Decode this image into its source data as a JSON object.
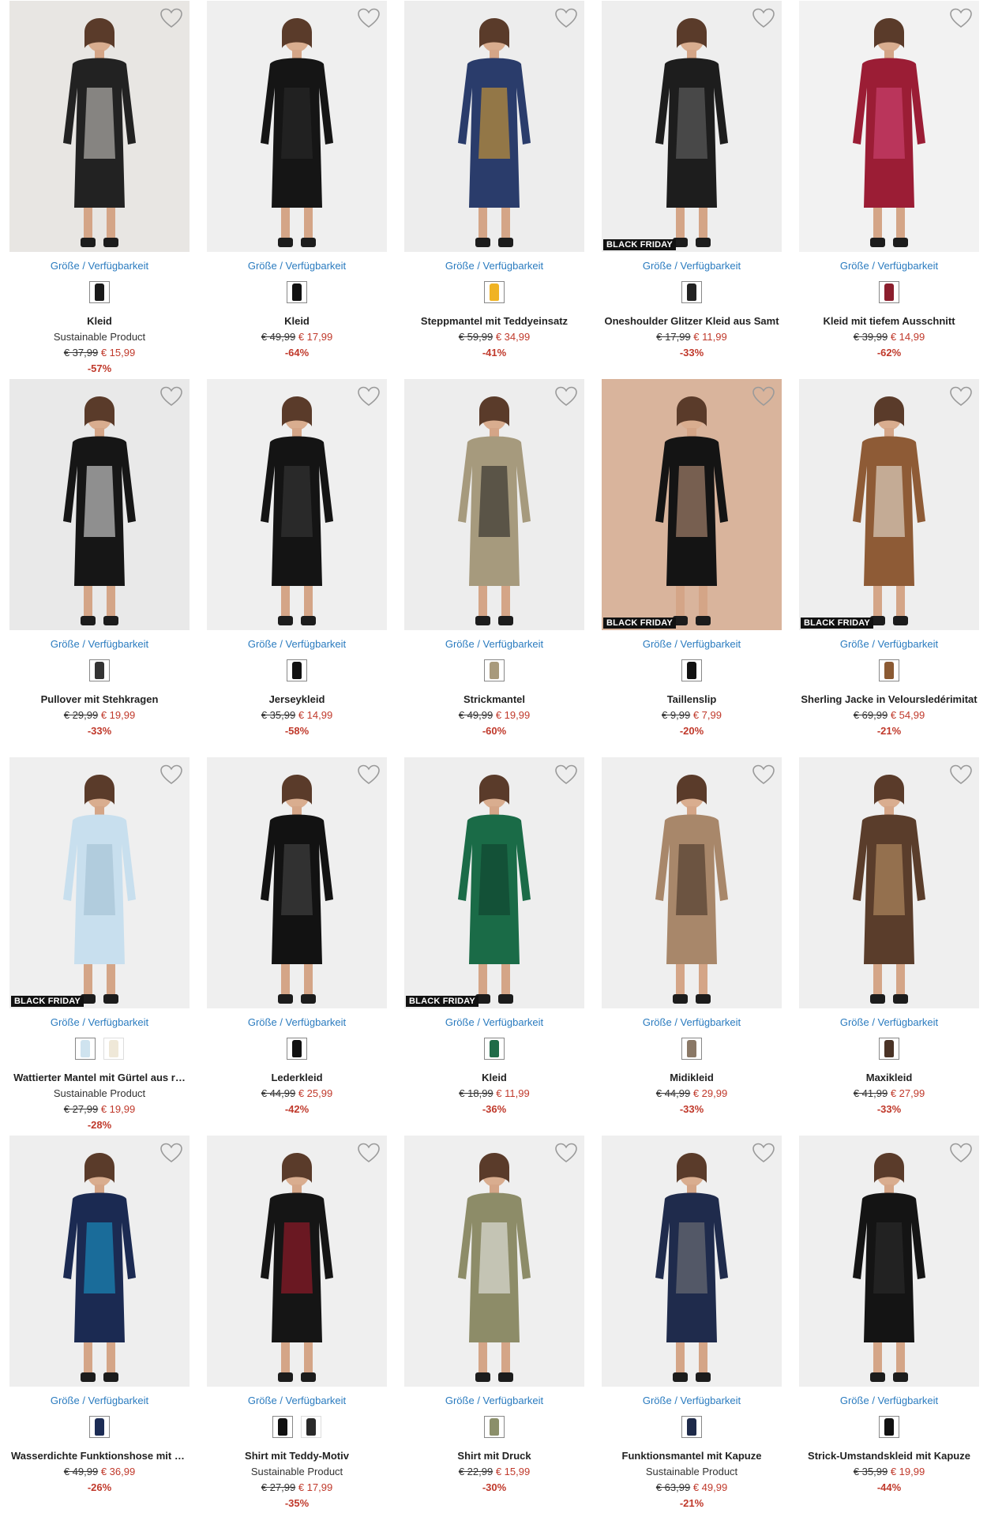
{
  "common": {
    "size_link": "Größe / Verfügbarkeit",
    "badge_black_friday": "BLACK FRIDAY",
    "heart_icon": "heart-outline-icon"
  },
  "products": [
    {
      "title": "Kleid",
      "sustainable": "Sustainable Product",
      "old_price": "€ 37,99",
      "new_price": "€ 15,99",
      "discount": "-57%",
      "black_friday": false,
      "swatches": [
        "#1a1a1a"
      ],
      "image_color": "#e8e6e3",
      "garment": "#222222",
      "accent": "#d9d6cf"
    },
    {
      "title": "Kleid",
      "sustainable": "",
      "old_price": "€ 49,99",
      "new_price": "€ 17,99",
      "discount": "-64%",
      "black_friday": false,
      "swatches": [
        "#111111"
      ],
      "image_color": "#efefef",
      "garment": "#151515",
      "accent": "#2b2b2b"
    },
    {
      "title": "Steppmantel mit Teddyeinsatz",
      "sustainable": "",
      "old_price": "€ 59,99",
      "new_price": "€ 34,99",
      "discount": "-41%",
      "black_friday": false,
      "swatches": [
        "#f0b323"
      ],
      "image_color": "#ededed",
      "garment": "#2a3c6b",
      "accent": "#e9a82a"
    },
    {
      "title": "Oneshoulder Glitzer Kleid aus Samt",
      "sustainable": "",
      "old_price": "€ 17,99",
      "new_price": "€ 11,99",
      "discount": "-33%",
      "black_friday": true,
      "swatches": [
        "#222222"
      ],
      "image_color": "#eeeeee",
      "garment": "#1d1d1d",
      "accent": "#6b6b6b"
    },
    {
      "title": "Kleid mit tiefem Ausschnitt",
      "sustainable": "",
      "old_price": "€ 39,99",
      "new_price": "€ 14,99",
      "discount": "-62%",
      "black_friday": false,
      "swatches": [
        "#8b1e2d"
      ],
      "image_color": "#f2f2f2",
      "garment": "#9b1d35",
      "accent": "#d4487a"
    },
    {
      "title": "Pullover mit Stehkragen",
      "sustainable": "",
      "old_price": "€ 29,99",
      "new_price": "€ 19,99",
      "discount": "-33%",
      "black_friday": false,
      "swatches": [
        "#333333"
      ],
      "image_color": "#e9e9e9",
      "garment": "#161616",
      "accent": "#f4f4f4"
    },
    {
      "title": "Jerseykleid",
      "sustainable": "",
      "old_price": "€ 35,99",
      "new_price": "€ 14,99",
      "discount": "-58%",
      "black_friday": false,
      "swatches": [
        "#111111"
      ],
      "image_color": "#efefef",
      "garment": "#141414",
      "accent": "#3a3a3a"
    },
    {
      "title": "Strickmantel",
      "sustainable": "",
      "old_price": "€ 49,99",
      "new_price": "€ 19,99",
      "discount": "-60%",
      "black_friday": false,
      "swatches": [
        "#a89a7c"
      ],
      "image_color": "#ededed",
      "garment": "#a69a7d",
      "accent": "#1b1b1b"
    },
    {
      "title": "Taillenslip",
      "sustainable": "",
      "old_price": "€ 9,99",
      "new_price": "€ 7,99",
      "discount": "-20%",
      "black_friday": true,
      "swatches": [
        "#111111"
      ],
      "image_color": "#d9b49c",
      "garment": "#141414",
      "accent": "#c99d82"
    },
    {
      "title": "Sherling Jacke in Veloursledérimitat",
      "sustainable": "",
      "old_price": "€ 69,99",
      "new_price": "€ 54,99",
      "discount": "-21%",
      "black_friday": true,
      "swatches": [
        "#8b5a33"
      ],
      "image_color": "#eeeeee",
      "garment": "#8e5b36",
      "accent": "#f1ece3"
    },
    {
      "title": "Wattierter Mantel mit Gürtel aus r…",
      "sustainable": "Sustainable Product",
      "old_price": "€ 27,99",
      "new_price": "€ 19,99",
      "discount": "-28%",
      "black_friday": true,
      "swatches": [
        "#cfe3ef",
        "#efe8d8"
      ],
      "image_color": "#efefef",
      "garment": "#c8dfee",
      "accent": "#9fbcd0"
    },
    {
      "title": "Lederkleid",
      "sustainable": "",
      "old_price": "€ 44,99",
      "new_price": "€ 25,99",
      "discount": "-42%",
      "black_friday": false,
      "swatches": [
        "#111111"
      ],
      "image_color": "#efefef",
      "garment": "#121212",
      "accent": "#4a4a4a"
    },
    {
      "title": "Kleid",
      "sustainable": "",
      "old_price": "€ 18,99",
      "new_price": "€ 11,99",
      "discount": "-36%",
      "black_friday": true,
      "swatches": [
        "#1f6b48"
      ],
      "image_color": "#eeeeee",
      "garment": "#1a6b47",
      "accent": "#0f3d2a"
    },
    {
      "title": "Midikleid",
      "sustainable": "",
      "old_price": "€ 44,99",
      "new_price": "€ 29,99",
      "discount": "-33%",
      "black_friday": false,
      "swatches": [
        "#8a7866"
      ],
      "image_color": "#efefef",
      "garment": "#a8876a",
      "accent": "#3b2a1f"
    },
    {
      "title": "Maxikleid",
      "sustainable": "",
      "old_price": "€ 41,99",
      "new_price": "€ 27,99",
      "discount": "-33%",
      "black_friday": false,
      "swatches": [
        "#4a3326"
      ],
      "image_color": "#efefef",
      "garment": "#5a3d2b",
      "accent": "#c49a6c"
    },
    {
      "title": "Wasserdichte Funktionshose mit R…",
      "sustainable": "",
      "old_price": "€ 49,99",
      "new_price": "€ 36,99",
      "discount": "-26%",
      "black_friday": false,
      "swatches": [
        "#1c2c55"
      ],
      "image_color": "#eeeeee",
      "garment": "#1b2a52",
      "accent": "#1aa3d6"
    },
    {
      "title": "Shirt mit Teddy-Motiv",
      "sustainable": "Sustainable Product",
      "old_price": "€ 27,99",
      "new_price": "€ 17,99",
      "discount": "-35%",
      "black_friday": false,
      "swatches": [
        "#111111",
        "#2a2a2a"
      ],
      "image_color": "#efefef",
      "garment": "#151515",
      "accent": "#b01c2e"
    },
    {
      "title": "Shirt mit Druck",
      "sustainable": "",
      "old_price": "€ 22,99",
      "new_price": "€ 15,99",
      "discount": "-30%",
      "black_friday": false,
      "swatches": [
        "#8b8f6a"
      ],
      "image_color": "#efefef",
      "garment": "#8d8c68",
      "accent": "#f2f2f2"
    },
    {
      "title": "Funktionsmantel mit Kapuze",
      "sustainable": "Sustainable Product",
      "old_price": "€ 63,99",
      "new_price": "€ 49,99",
      "discount": "-21%",
      "black_friday": false,
      "swatches": [
        "#1e2a4a"
      ],
      "image_color": "#efefef",
      "garment": "#1f2b4c",
      "accent": "#7d7d7d"
    },
    {
      "title": "Strick-Umstandskleid mit Kapuze",
      "sustainable": "",
      "old_price": "€ 35,99",
      "new_price": "€ 19,99",
      "discount": "-44%",
      "black_friday": false,
      "swatches": [
        "#111111"
      ],
      "image_color": "#efefef",
      "garment": "#141414",
      "accent": "#2d2d2d"
    }
  ]
}
